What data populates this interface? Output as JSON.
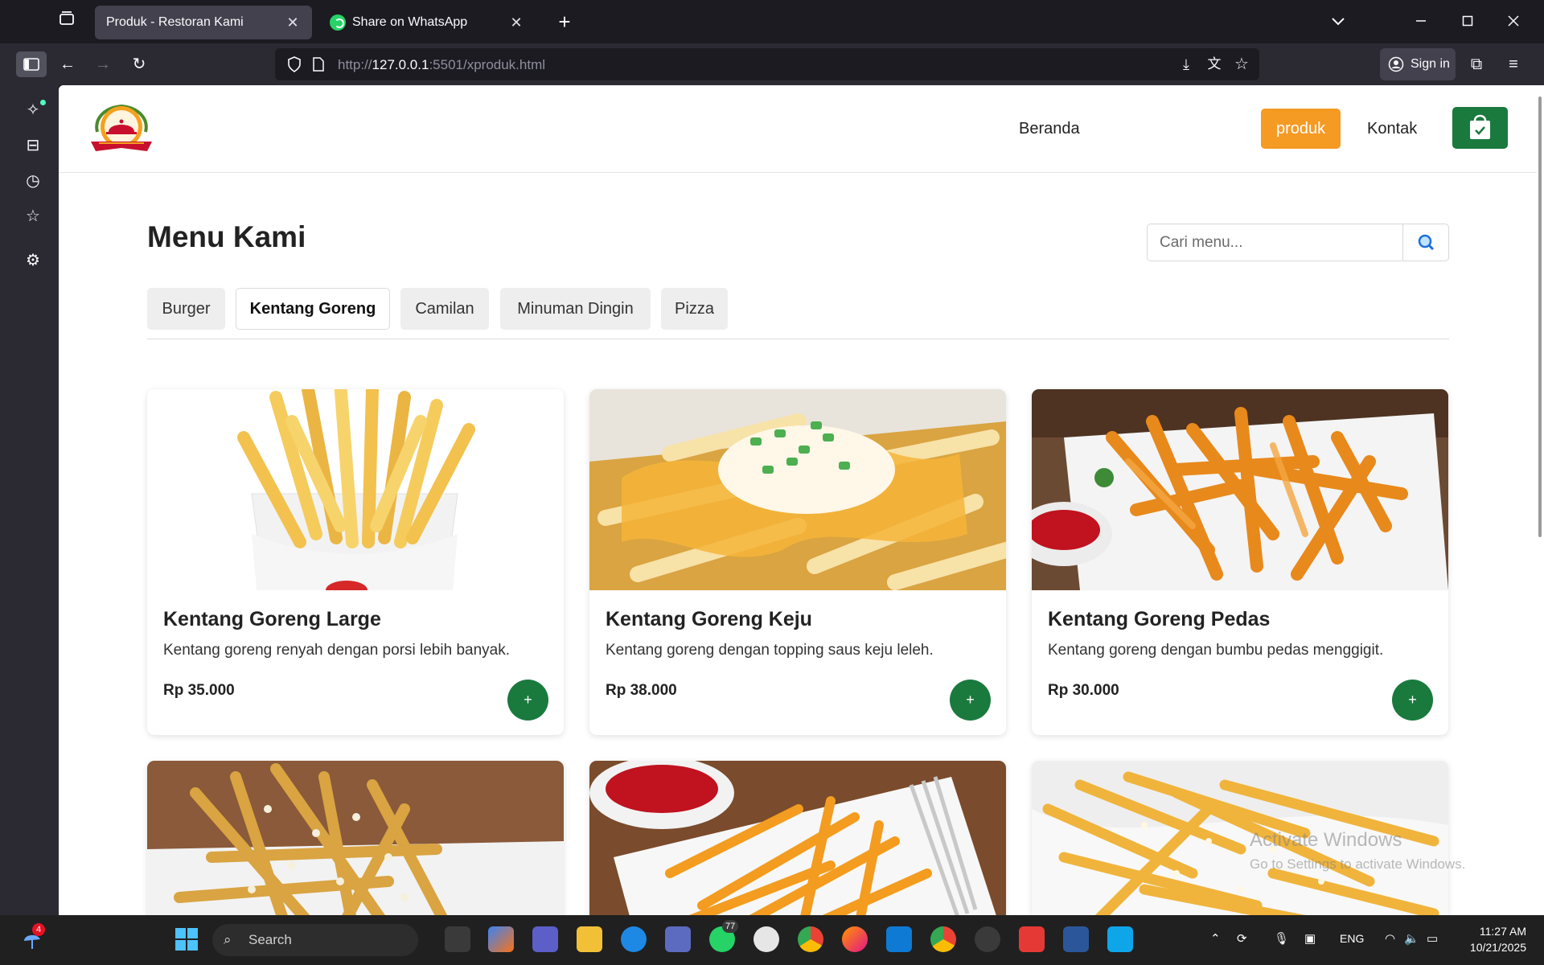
{
  "browser": {
    "tabs": [
      {
        "title": "Produk - Restoran Kami"
      },
      {
        "title": "Share on WhatsApp"
      }
    ],
    "url_host": "127.0.0.1",
    "url_prefix": "http://",
    "url_suffix": ":5501/xproduk.html",
    "signin_label": "Sign in"
  },
  "site": {
    "nav": [
      "Beranda",
      "produk",
      "Kontak"
    ],
    "menu_title": "Menu Kami",
    "search_placeholder": "Cari menu...",
    "categories": [
      "Burger",
      "Kentang Goreng",
      "Camilan",
      "Minuman Dingin",
      "Pizza"
    ],
    "active_category": "Kentang Goreng",
    "products": [
      {
        "name": "Kentang Goreng Large",
        "desc": "Kentang goreng renyah dengan porsi lebih banyak.",
        "price": "Rp 35.000"
      },
      {
        "name": "Kentang Goreng Keju",
        "desc": "Kentang goreng dengan topping saus keju leleh.",
        "price": "Rp 38.000"
      },
      {
        "name": "Kentang Goreng Pedas",
        "desc": "Kentang goreng dengan bumbu pedas menggigit.",
        "price": "Rp 30.000"
      }
    ],
    "add_label": "+",
    "colors": {
      "accent": "#f59a23",
      "primary": "#1a7a3e"
    }
  },
  "overlay": {
    "watermark_title": "Activate Windows",
    "watermark_sub": "Go to Settings to activate Windows."
  },
  "taskbar": {
    "search_label": "Search",
    "lang": "ENG",
    "time": "11:27 AM",
    "date": "10/21/2025",
    "weather_badge": "4",
    "whatsapp_badge": "77"
  }
}
